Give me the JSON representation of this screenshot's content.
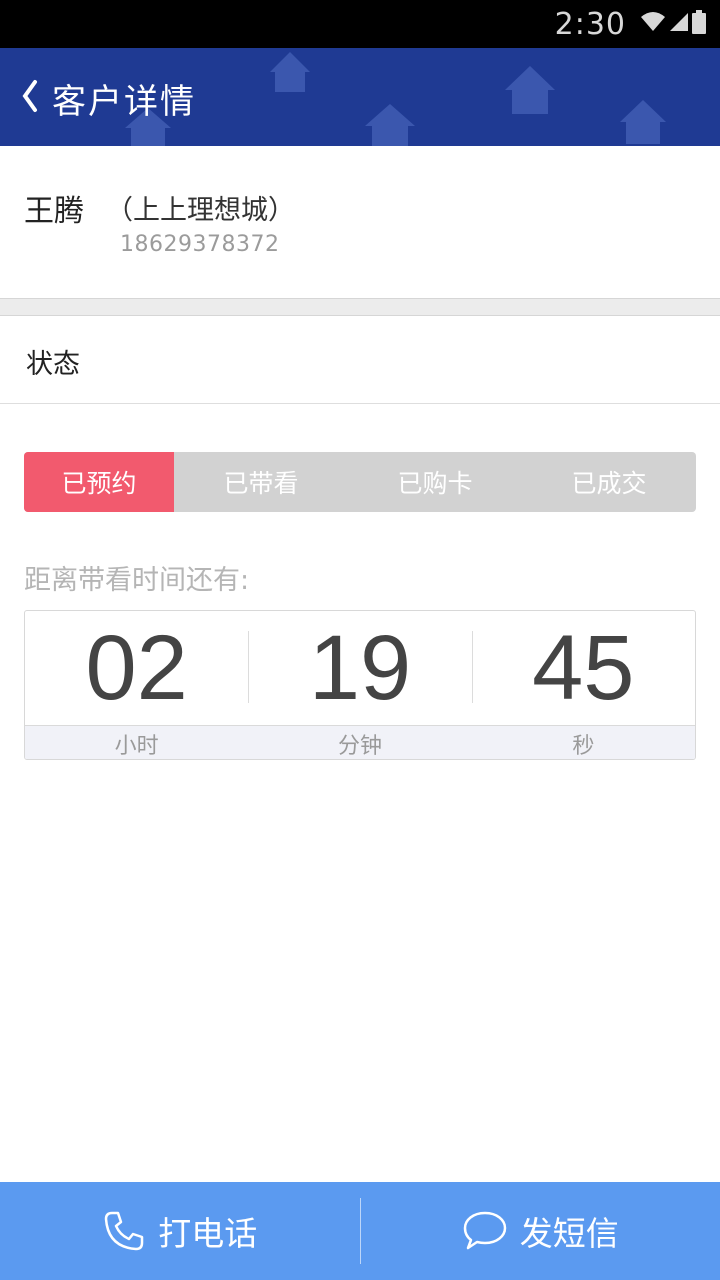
{
  "status_bar": {
    "time": "2:30",
    "icons": [
      "wifi-icon",
      "signal-icon",
      "battery-icon"
    ]
  },
  "header": {
    "title": "客户详情",
    "back_icon": "chevron-left-icon",
    "background": "#1f3a93"
  },
  "customer": {
    "name": "王腾",
    "project": "（上上理想城）",
    "phone": "18629378372"
  },
  "status_section": {
    "label": "状态"
  },
  "steps": [
    {
      "label": "已预约",
      "active": true
    },
    {
      "label": "已带看",
      "active": false
    },
    {
      "label": "已购卡",
      "active": false
    },
    {
      "label": "已成交",
      "active": false
    }
  ],
  "countdown": {
    "label": "距离带看时间还有:",
    "hours": "02",
    "minutes": "19",
    "seconds": "45",
    "hours_unit": "小时",
    "minutes_unit": "分钟",
    "seconds_unit": "秒"
  },
  "bottom_bar": {
    "call_label": "打电话",
    "sms_label": "发短信",
    "background": "#5b9af0"
  },
  "colors": {
    "accent": "#f25a6e",
    "inactive_step": "#d2d2d2"
  }
}
